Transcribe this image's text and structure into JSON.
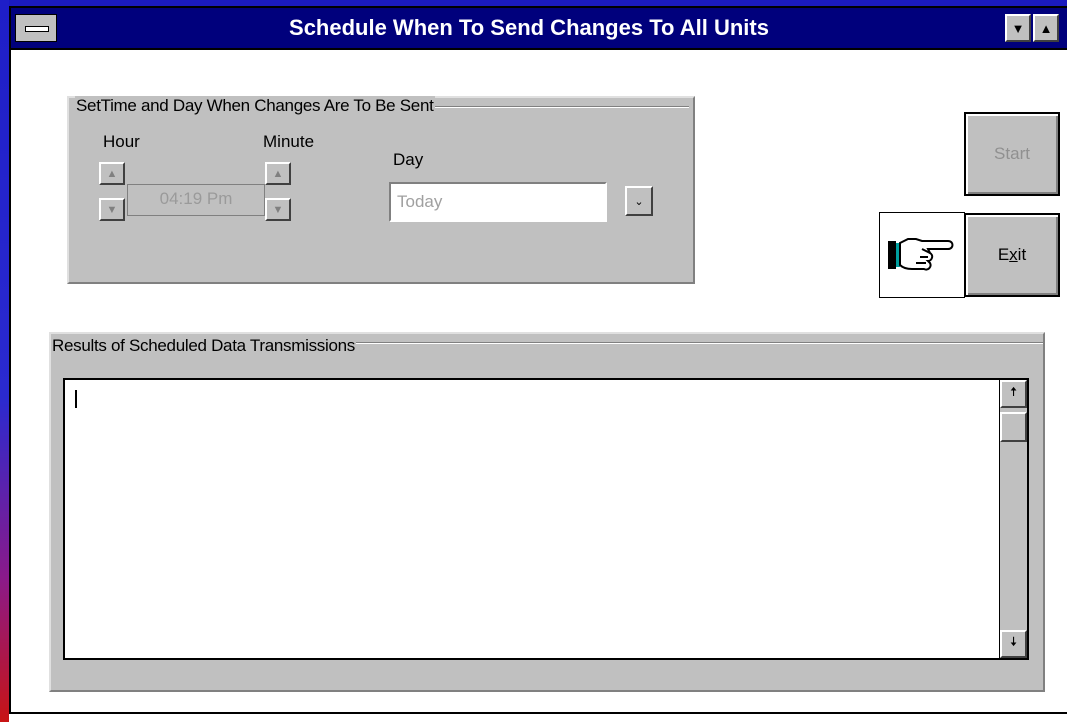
{
  "window": {
    "title": "Schedule When To Send Changes To All Units",
    "title_color": "#00007c",
    "title_text_color": "#ffffff"
  },
  "titlebar_buttons": {
    "minimize_icon": "triangle-down",
    "maximize_icon": "triangle-up"
  },
  "schedule_group": {
    "label": "SetTime and Day When Changes Are To Be Sent",
    "hour_label": "Hour",
    "minute_label": "Minute",
    "day_label": "Day",
    "time_value": "04:19 Pm",
    "day_value": "Today"
  },
  "buttons": {
    "start_label": "Start",
    "exit_label": "Exit",
    "exit_mnemonic": "x"
  },
  "results_group": {
    "label": "Results of Scheduled Data Transmissions",
    "text": ""
  },
  "colors": {
    "face": "#c0c0c0",
    "disabled_text": "#9a9a9a"
  }
}
